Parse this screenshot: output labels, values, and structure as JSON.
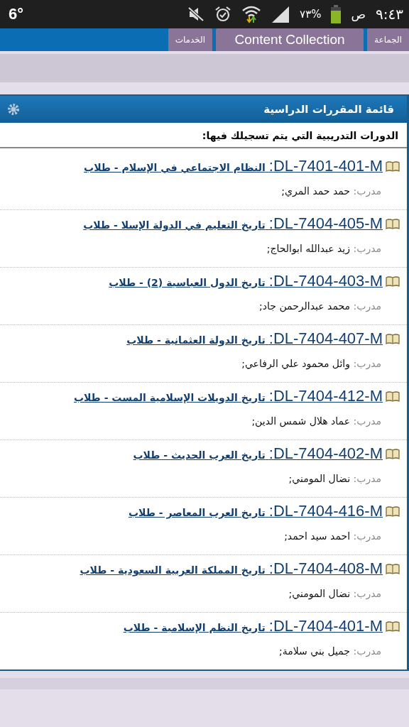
{
  "status_bar": {
    "temperature": "6°",
    "battery_percent": "٧٣%",
    "am_pm": "ص",
    "time": "٩:٤٣"
  },
  "tabs": [
    {
      "label": "الجماعة"
    },
    {
      "label": "Content Collection"
    },
    {
      "label": "الخدمات"
    }
  ],
  "panel": {
    "title": "قائمة المقررات الدراسية",
    "subtitle": "الدورات التدريبية التي يتم تسجيلك فيها:",
    "courses": [
      {
        "code": "DL-7401-401-M:",
        "title": "النظام الاجتماعي في الإسلام - طلاب",
        "instructor_label": "مدرب:",
        "instructor": "حمد حمد المري;"
      },
      {
        "code": "DL-7404-405-M:",
        "title": "تاريخ التعليم في الدولة الإسلا - طلاب",
        "instructor_label": "مدرب:",
        "instructor": "زيد عبدالله ابوالحاج;"
      },
      {
        "code": "DL-7404-403-M:",
        "title": "تاريخ الدول العباسية (2) - طلاب",
        "instructor_label": "مدرب:",
        "instructor": "محمد عبدالرحمن جاد;"
      },
      {
        "code": "DL-7404-407-M:",
        "title": "تاريخ الدولة العثمانية - طلاب",
        "instructor_label": "مدرب:",
        "instructor": "وائل محمود علي الرفاعي;"
      },
      {
        "code": "DL-7404-412-M:",
        "title": "تاريخ الدويلات الإسلامية المست - طلاب",
        "instructor_label": "مدرب:",
        "instructor": "عماد هلال شمس الدين;"
      },
      {
        "code": "DL-7404-402-M:",
        "title": "تاريخ العرب الحديث - طلاب",
        "instructor_label": "مدرب:",
        "instructor": "نضال المومني;"
      },
      {
        "code": "DL-7404-416-M:",
        "title": "تاريخ العرب المعاصر - طلاب",
        "instructor_label": "مدرب:",
        "instructor": "احمد سيد احمد;"
      },
      {
        "code": "DL-7404-408-M:",
        "title": "تاريخ المملكة العربية السعودية - طلاب",
        "instructor_label": "مدرب:",
        "instructor": "نضال المومني;"
      },
      {
        "code": "DL-7404-401-M:",
        "title": "تاريخ النظم الإسلامية - طلاب",
        "instructor_label": "مدرب:",
        "instructor": "جميل بني سلامة;"
      }
    ]
  }
}
